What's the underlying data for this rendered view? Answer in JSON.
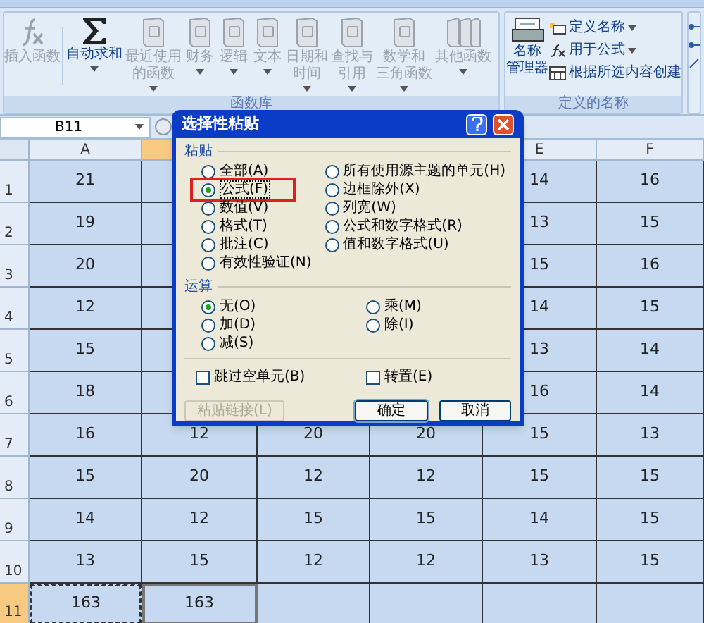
{
  "ribbon": {
    "function_group": {
      "title": "函数库",
      "items": [
        {
          "kind": "fx",
          "lines": [
            "插入函数"
          ],
          "dropdown": false,
          "disabled": true
        },
        {
          "kind": "sigma",
          "lines": [
            "自动求和"
          ],
          "dropdown": true,
          "disabled": false
        },
        {
          "kind": "book",
          "lines": [
            "最近使用",
            "的函数"
          ],
          "dropdown": true,
          "disabled": true
        },
        {
          "kind": "book",
          "lines": [
            "财务"
          ],
          "dropdown": true,
          "disabled": true
        },
        {
          "kind": "book",
          "lines": [
            "逻辑"
          ],
          "dropdown": true,
          "disabled": true
        },
        {
          "kind": "book",
          "lines": [
            "文本"
          ],
          "dropdown": true,
          "disabled": true
        },
        {
          "kind": "book",
          "lines": [
            "日期和",
            "时间"
          ],
          "dropdown": true,
          "disabled": true
        },
        {
          "kind": "book",
          "lines": [
            "查找与",
            "引用"
          ],
          "dropdown": true,
          "disabled": true
        },
        {
          "kind": "book",
          "lines": [
            "数学和",
            "三角函数"
          ],
          "dropdown": true,
          "disabled": true
        },
        {
          "kind": "books",
          "lines": [
            "其他函数"
          ],
          "dropdown": true,
          "disabled": true
        }
      ]
    },
    "names_group": {
      "title": "定义的名称",
      "manager": {
        "lines": [
          "名称",
          "管理器"
        ]
      },
      "items": [
        {
          "kind": "tag",
          "label": "定义名称",
          "dropdown": true
        },
        {
          "kind": "fx",
          "label": "用于公式",
          "dropdown": true
        },
        {
          "kind": "grid",
          "label": "根据所选内容创建",
          "dropdown": false
        }
      ]
    }
  },
  "formula_bar": {
    "name_box": "B11"
  },
  "sheet": {
    "columns": [
      {
        "label": "A",
        "selected": false
      },
      {
        "selected": true
      },
      null,
      null,
      {
        "label": "E",
        "selected": false
      },
      {
        "label": "F",
        "selected": false
      }
    ],
    "rows": [
      {
        "number": "1",
        "selected": false,
        "cells": [
          "21",
          null,
          null,
          null,
          "14",
          "16"
        ]
      },
      {
        "number": "2",
        "selected": false,
        "cells": [
          "19",
          null,
          null,
          null,
          "13",
          "15"
        ]
      },
      {
        "number": "3",
        "selected": false,
        "cells": [
          "20",
          null,
          null,
          null,
          "15",
          "16"
        ]
      },
      {
        "number": "4",
        "selected": false,
        "cells": [
          "12",
          null,
          null,
          null,
          "14",
          "15"
        ]
      },
      {
        "number": "5",
        "selected": false,
        "cells": [
          "15",
          null,
          null,
          null,
          "13",
          "14"
        ]
      },
      {
        "number": "6",
        "selected": false,
        "cells": [
          "18",
          null,
          null,
          null,
          "16",
          "14"
        ]
      },
      {
        "number": "7",
        "selected": false,
        "cells": [
          "16",
          "12",
          "20",
          "20",
          "15",
          "13"
        ]
      },
      {
        "number": "8",
        "selected": false,
        "cells": [
          "15",
          "20",
          "12",
          "12",
          "15",
          "15"
        ]
      },
      {
        "number": "9",
        "selected": false,
        "cells": [
          "14",
          "12",
          "15",
          "15",
          "14",
          "15"
        ]
      },
      {
        "number": "10",
        "selected": false,
        "cells": [
          "13",
          "15",
          "12",
          "12",
          "13",
          "15"
        ]
      },
      {
        "number": "11",
        "selected": true,
        "cells": [
          "163",
          "163"
        ],
        "cell_marks": [
          {
            "copied": true,
            "active": false
          },
          {
            "copied": false,
            "active": true
          }
        ]
      }
    ]
  },
  "dialog": {
    "title": "选择性粘贴",
    "paste": {
      "title": "粘贴",
      "left": [
        {
          "label": "全部(A)",
          "selected": false,
          "highlighted": false
        },
        {
          "label": "公式(F)",
          "selected": true,
          "highlighted": true
        },
        {
          "label": "数值(V)",
          "selected": false,
          "highlighted": false
        },
        {
          "label": "格式(T)",
          "selected": false,
          "highlighted": false
        },
        {
          "label": "批注(C)",
          "selected": false,
          "highlighted": false
        },
        {
          "label": "有效性验证(N)",
          "selected": false,
          "highlighted": false
        }
      ],
      "right": [
        {
          "label": "所有使用源主题的单元(H)",
          "selected": false,
          "highlighted": false
        },
        {
          "label": "边框除外(X)",
          "selected": false,
          "highlighted": false
        },
        {
          "label": "列宽(W)",
          "selected": false,
          "highlighted": false
        },
        {
          "label": "公式和数字格式(R)",
          "selected": false,
          "highlighted": false
        },
        {
          "label": "值和数字格式(U)",
          "selected": false,
          "highlighted": false
        }
      ]
    },
    "operation": {
      "title": "运算",
      "left": [
        {
          "label": "无(O)",
          "selected": true,
          "highlighted": false
        },
        {
          "label": "加(D)",
          "selected": false,
          "highlighted": false
        },
        {
          "label": "减(S)",
          "selected": false,
          "highlighted": false
        }
      ],
      "right": [
        {
          "label": "乘(M)",
          "selected": false,
          "highlighted": false
        },
        {
          "label": "除(I)",
          "selected": false,
          "highlighted": false
        }
      ]
    },
    "checkboxes": [
      {
        "label": "跳过空单元(B)",
        "checked": false
      },
      {
        "label": "转置(E)",
        "checked": false
      }
    ],
    "buttons": [
      {
        "label": "粘贴链接(L)",
        "disabled": true,
        "default": false
      },
      {
        "label": "确定",
        "disabled": false,
        "default": true
      },
      {
        "label": "取消",
        "disabled": false,
        "default": false
      }
    ]
  }
}
